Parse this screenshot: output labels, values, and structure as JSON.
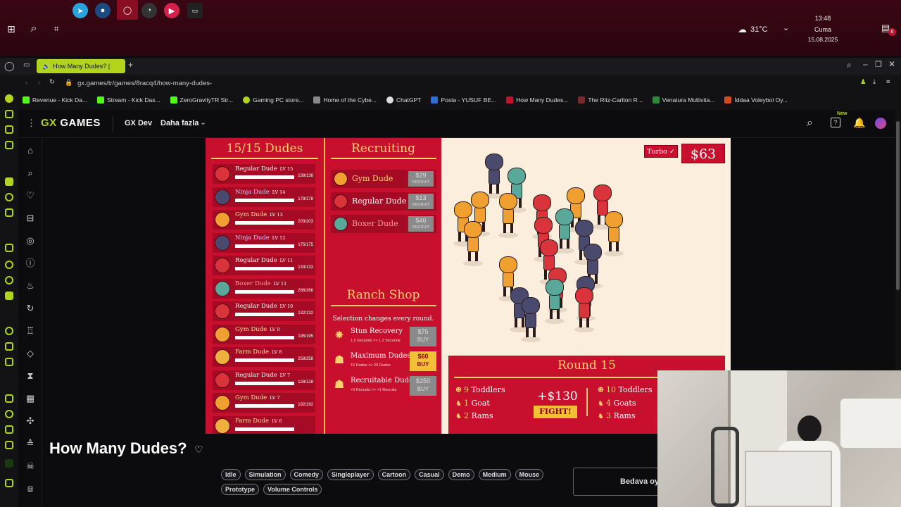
{
  "taskbar": {
    "weather": "31°C",
    "time": "13:48",
    "day": "Cuma",
    "date": "15.08.2025",
    "notification_count": "6"
  },
  "browser": {
    "tab_title": "How Many Dudes? |",
    "address": "gx.games/tr/games/8racq4/how-many-dudes-",
    "bookmarks": [
      "Revenue - Kick Da...",
      "Stream - Kick Das...",
      "ZeroGravityTR Str...",
      "Gaming PC store...",
      "Home of the Cybe...",
      "ChatGPT",
      "Posta - YUSUF BE...",
      "How Many Dudes...",
      "The Ritz-Carlton R...",
      "Venatura Multivita...",
      "İddaa Voleybol Oy..."
    ]
  },
  "gx": {
    "logo_gx": "GX",
    "logo_games": "GAMES",
    "nav_dev": "GX Dev",
    "nav_more": "Daha fazla",
    "new_badge": "New"
  },
  "game": {
    "dudes_title": "15/15 Dudes",
    "recruit_title": "Recruiting",
    "shop_title": "Ranch Shop",
    "shop_subtitle": "Selection changes every round.",
    "turbo_label": "Turbo ✓",
    "money": "$63",
    "dudes": [
      {
        "name": "Regular Dude",
        "lv": "LV 15",
        "hp": "138/138",
        "color": "#d9343c"
      },
      {
        "name": "Ninja Dude",
        "lv": "LV 14",
        "hp": "178/178",
        "color": "#4a4a6e"
      },
      {
        "name": "Gym Dude",
        "lv": "LV 13",
        "hp": "203/203",
        "color": "#f0a030"
      },
      {
        "name": "Ninja Dude",
        "lv": "LV 12",
        "hp": "175/175",
        "color": "#4a4a6e"
      },
      {
        "name": "Regular Dude",
        "lv": "LV 11",
        "hp": "133/133",
        "color": "#d9343c"
      },
      {
        "name": "Boxer Dude",
        "lv": "LV 11",
        "hp": "266/266",
        "color": "#5aa89a"
      },
      {
        "name": "Regular Dude",
        "lv": "LV 10",
        "hp": "132/132",
        "color": "#d9343c"
      },
      {
        "name": "Gym Dude",
        "lv": "LV 9",
        "hp": "195/195",
        "color": "#f0a030"
      },
      {
        "name": "Farm Dude",
        "lv": "LV 8",
        "hp": "258/258",
        "color": "#f0b040"
      },
      {
        "name": "Regular Dude",
        "lv": "LV 7",
        "hp": "128/128",
        "color": "#d9343c"
      },
      {
        "name": "Gym Dude",
        "lv": "LV 7",
        "hp": "192/192",
        "color": "#f0a030"
      },
      {
        "name": "Farm Dude",
        "lv": "LV 6",
        "hp": "",
        "color": "#f0b040"
      }
    ],
    "recruits": [
      {
        "name": "Gym Dude",
        "price": "$29",
        "action": "RECRUIT",
        "color": "#f0a030",
        "text_color": "#ffd36a"
      },
      {
        "name": "Regular Dude",
        "price": "$13",
        "action": "RECRUIT",
        "color": "#d9343c",
        "text_color": "#ffffff"
      },
      {
        "name": "Boxer Dude",
        "price": "$46",
        "action": "RECRUIT",
        "color": "#5aa89a",
        "text_color": "#ff9a9a"
      }
    ],
    "shop": [
      {
        "icon": "✸",
        "name": "Stun Recovery",
        "desc": "1.5 Seconds >> 1.2 Seconds",
        "price": "$75",
        "action": "BUY",
        "active": false
      },
      {
        "icon": "☗",
        "name": "Maximum Dudes",
        "desc": "15 Dudes >> 20 Dudes",
        "price": "$60",
        "action": "BUY",
        "active": true
      },
      {
        "icon": "☗",
        "name": "Recruitable Dudes",
        "desc": "+0 Recruits >> +1 Recruits",
        "price": "$250",
        "action": "BUY",
        "active": false
      }
    ],
    "round": {
      "title": "Round 15",
      "reward": "+$130",
      "fight_label": "FIGHT!",
      "left": [
        {
          "n": "9",
          "label": "Toddlers"
        },
        {
          "n": "1",
          "label": "Goat"
        },
        {
          "n": "2",
          "label": "Rams"
        }
      ],
      "right": [
        {
          "n": "10",
          "label": "Toddlers"
        },
        {
          "n": "4",
          "label": "Goats"
        },
        {
          "n": "3",
          "label": "Rams"
        }
      ]
    }
  },
  "info": {
    "title": "How Many Dudes?",
    "tags": [
      "Idle",
      "Simulation",
      "Comedy",
      "Singleplayer",
      "Cartoon",
      "Casual",
      "Demo",
      "Medium",
      "Mouse",
      "Prototype",
      "Volume Controls"
    ],
    "free_button": "Bedava oy"
  }
}
